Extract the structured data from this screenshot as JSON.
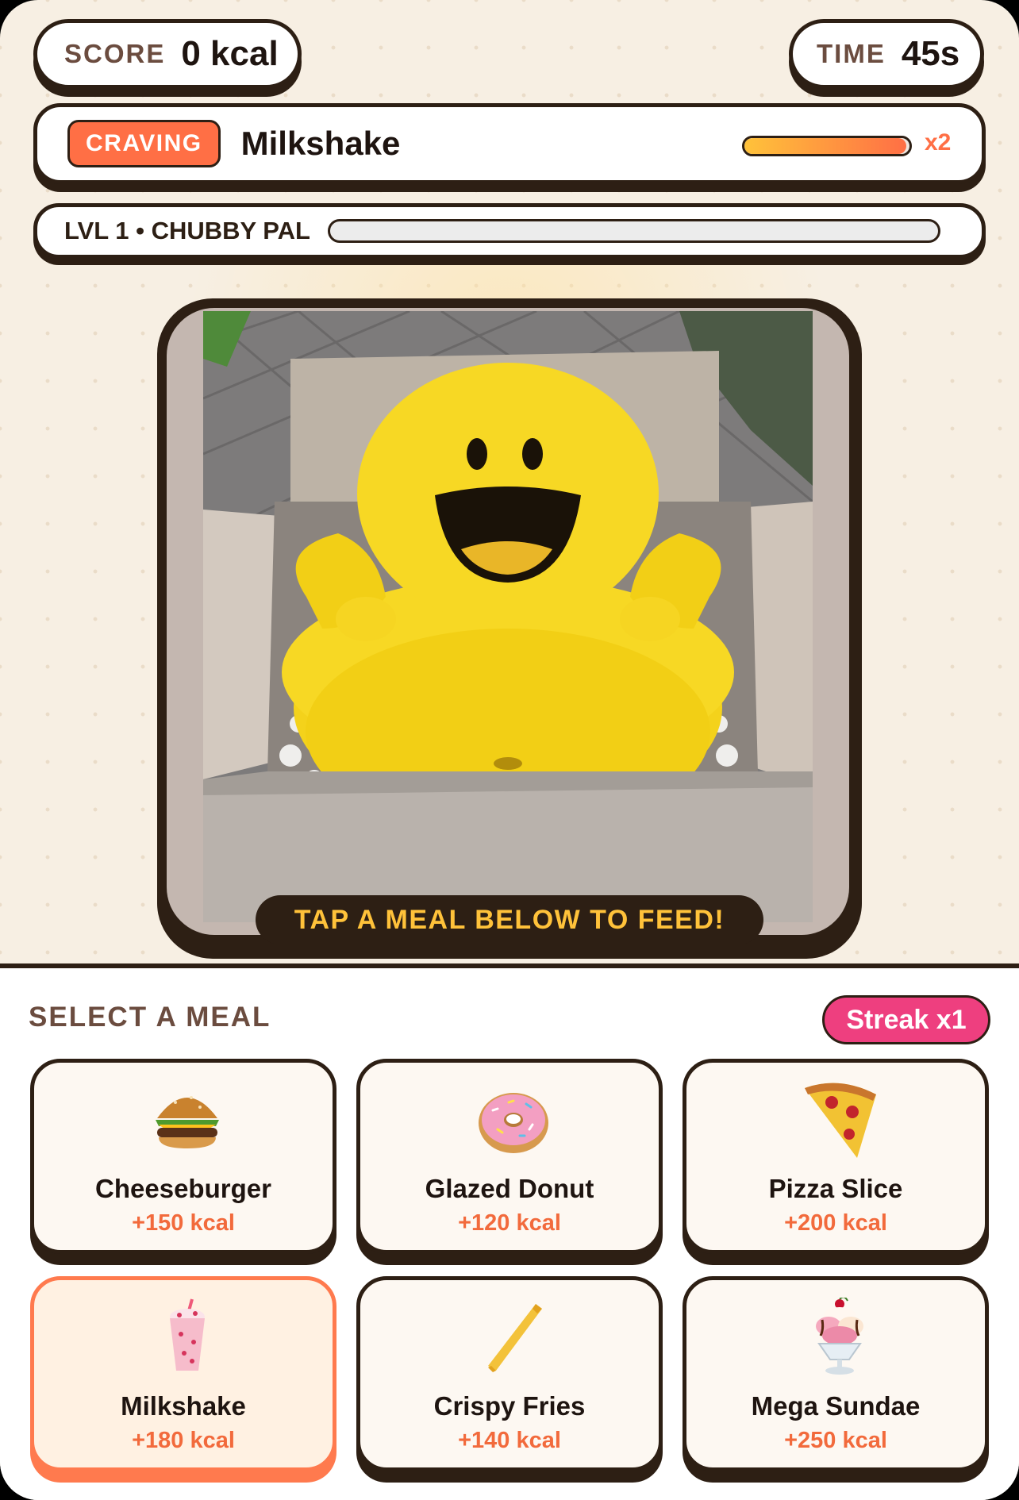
{
  "hud": {
    "score_label": "SCORE",
    "score_value": "0 kcal",
    "time_label": "TIME",
    "time_value": "45s"
  },
  "craving": {
    "badge": "CRAVING",
    "item": "Milkshake",
    "meter_fraction": 0.98,
    "multiplier": "x2"
  },
  "level": {
    "label": "LVL 1 • CHUBBY PAL",
    "progress_fraction": 0.0
  },
  "pet": {
    "image_icon": "yellow-chubby-smiley-in-box"
  },
  "feed_prompt": "TAP A MEAL BELOW TO FEED!",
  "meals_panel": {
    "title": "SELECT A MEAL",
    "streak": "Streak x1",
    "selected": "Milkshake",
    "meals": [
      {
        "name": "Cheeseburger",
        "kcal": "+150 kcal",
        "icon": "cheeseburger-icon"
      },
      {
        "name": "Glazed Donut",
        "kcal": "+120 kcal",
        "icon": "donut-icon"
      },
      {
        "name": "Pizza Slice",
        "kcal": "+200 kcal",
        "icon": "pizza-icon"
      },
      {
        "name": "Milkshake",
        "kcal": "+180 kcal",
        "icon": "milkshake-icon"
      },
      {
        "name": "Crispy Fries",
        "kcal": "+140 kcal",
        "icon": "fries-icon"
      },
      {
        "name": "Mega Sundae",
        "kcal": "+250 kcal",
        "icon": "sundae-icon"
      }
    ]
  },
  "colors": {
    "accent": "#ff6f45",
    "outline": "#2d1f14",
    "gold": "#ffc23a",
    "streak": "#ee3f7f",
    "background": "#f7efe3"
  }
}
